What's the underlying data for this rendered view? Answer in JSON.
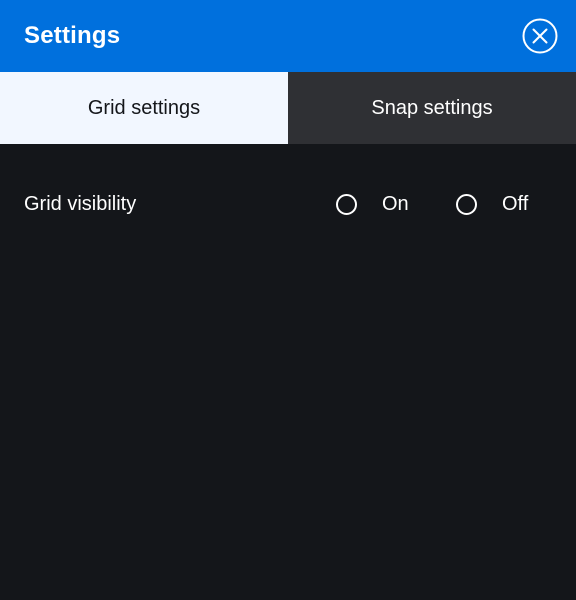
{
  "header": {
    "title": "Settings",
    "close_icon": "close-circle-icon",
    "background": "#0070dd"
  },
  "tabs": [
    {
      "label": "Grid settings",
      "active": true
    },
    {
      "label": "Snap settings",
      "active": false
    }
  ],
  "grid_visibility": {
    "label": "Grid visibility",
    "options": [
      {
        "label": "On",
        "selected": false
      },
      {
        "label": "Off",
        "selected": false
      }
    ]
  }
}
